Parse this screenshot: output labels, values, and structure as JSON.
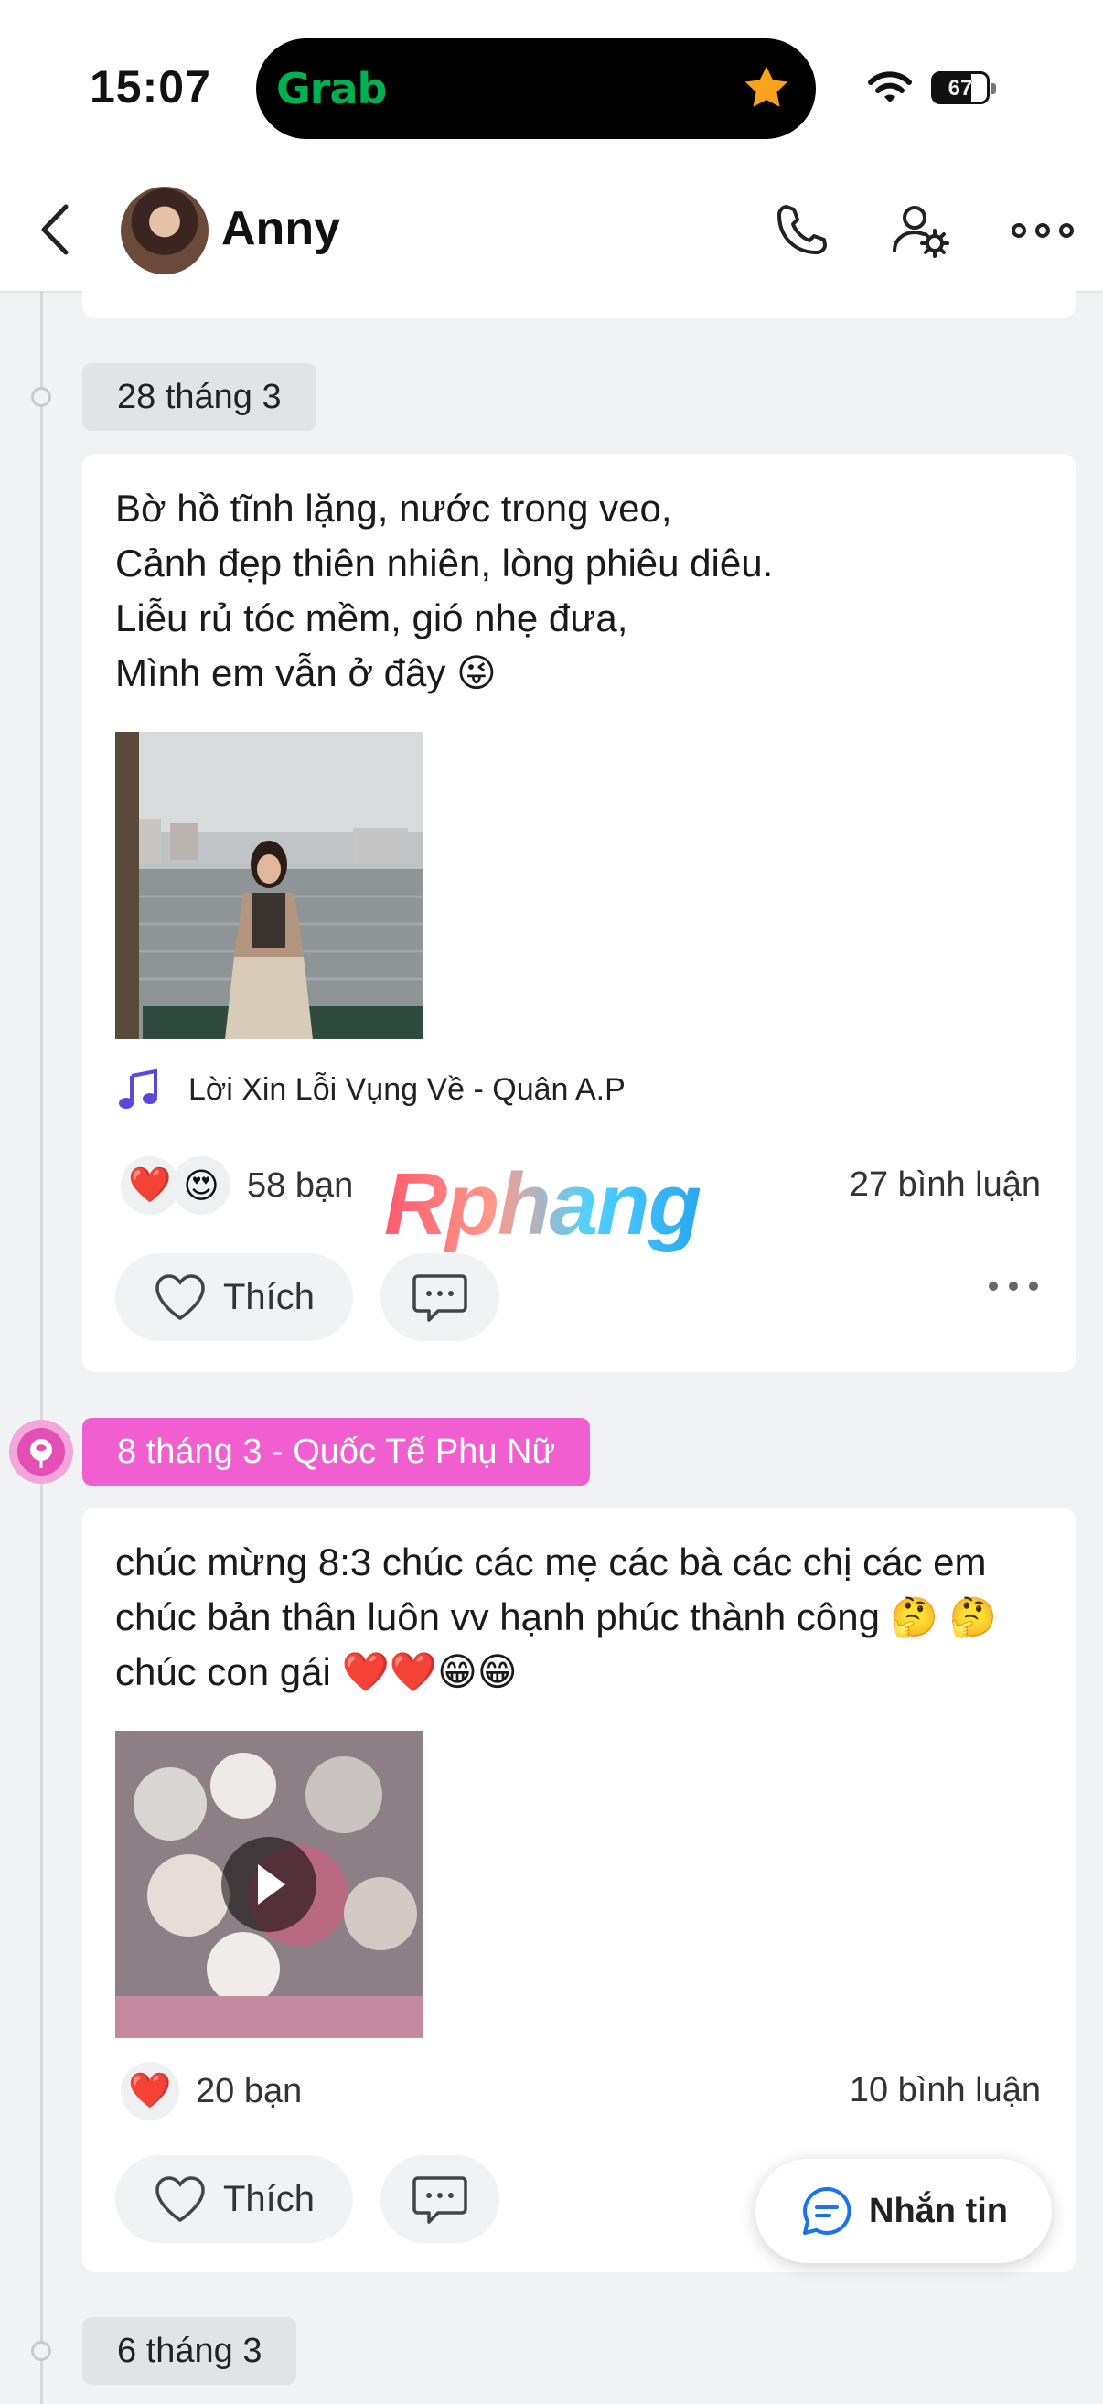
{
  "status": {
    "time": "15:07",
    "app_badge": "Grab",
    "battery": "67"
  },
  "header": {
    "name": "Anny"
  },
  "posts": [
    {
      "date": "28 tháng 3",
      "text": "Bờ hồ tĩnh lặng, nước trong veo,\nCảnh đẹp thiên nhiên, lòng phiêu diêu.\nLiễu rủ tóc mềm, gió nhẹ đưa,\nMình em vẫn ở đây 😜",
      "music": "Lời Xin Lỗi Vụng Về - Quân A.P",
      "reactions": [
        "❤️",
        "😍"
      ],
      "reaction_count": "58 bạn",
      "comments": "27 bình luận",
      "like_label": "Thích"
    },
    {
      "date": "8 tháng 3 - Quốc Tế Phụ Nữ",
      "text": "chúc mừng 8:3 chúc các mẹ các bà các chị các em chúc bản thân luôn vv hạnh phúc thành công 🤔 🤔 chúc con gái ❤️❤️😁😁",
      "reactions": [
        "❤️"
      ],
      "reaction_count": "20 bạn",
      "comments": "10 bình luận",
      "like_label": "Thích"
    },
    {
      "date": "6 tháng 3"
    }
  ],
  "watermark": "Rphang",
  "message_button": "Nhắn tin",
  "colors": {
    "accent": "#1a73e8",
    "pink": "#f05ed0",
    "grab": "#00b14f"
  }
}
